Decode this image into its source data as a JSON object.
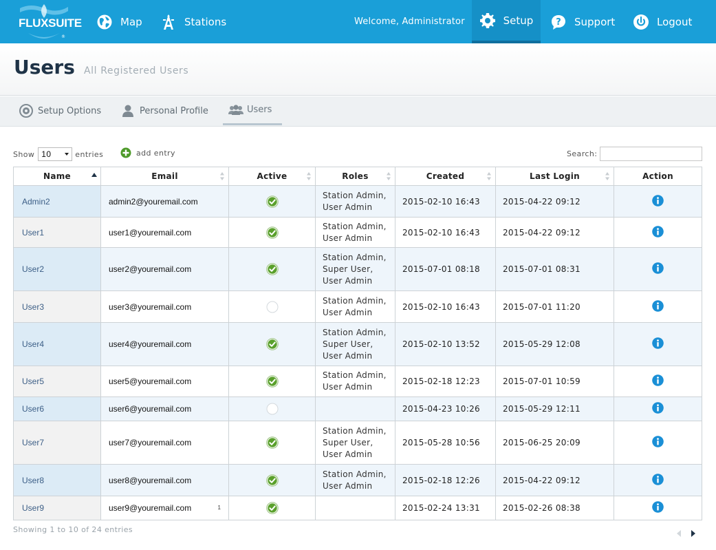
{
  "brand": {
    "logo_text": "FLUXSUITE",
    "reg_mark": "®",
    "color": "#1a9fd8"
  },
  "nav": {
    "map_label": "Map",
    "stations_label": "Stations",
    "welcome_text": "Welcome, Administrator",
    "setup_label": "Setup",
    "support_label": "Support",
    "logout_label": "Logout"
  },
  "page": {
    "title": "Users",
    "subtitle": "All Registered Users"
  },
  "subtabs": [
    {
      "label": "Setup Options",
      "icon": "gear-icon"
    },
    {
      "label": "Personal Profile",
      "icon": "person-icon"
    },
    {
      "label": "Users",
      "icon": "users-icon",
      "active": true
    }
  ],
  "controls": {
    "show_label": "Show",
    "page_length": "10",
    "entries_label": "entries",
    "add_entry_label": "add entry",
    "search_label": "Search:",
    "search_value": ""
  },
  "table": {
    "columns": [
      "Name",
      "Email",
      "Active",
      "Roles",
      "Created",
      "Last Login",
      "Action"
    ],
    "sorted_column": "Name",
    "sort_direction": "ascending",
    "rows": [
      {
        "name": "Admin2",
        "email": "admin2@youremail.com",
        "active": true,
        "roles": [
          "Station Admin,",
          "User Admin"
        ],
        "created": "2015-02-10 16:43",
        "last_login": "2015-04-22 09:12"
      },
      {
        "name": "User1",
        "email": "user1@youremail.com",
        "active": true,
        "roles": [
          "Station Admin,",
          "User Admin"
        ],
        "created": "2015-02-10 16:43",
        "last_login": "2015-04-22 09:12"
      },
      {
        "name": "User2",
        "email": "user2@youremail.com",
        "active": true,
        "roles": [
          "Station Admin,",
          "Super User,",
          "User Admin"
        ],
        "created": "2015-07-01 08:18",
        "last_login": "2015-07-01 08:31"
      },
      {
        "name": "User3",
        "email": "user3@youremail.com",
        "active": false,
        "roles": [
          "Station Admin,",
          "User Admin"
        ],
        "created": "2015-02-10 16:43",
        "last_login": "2015-07-01 11:20"
      },
      {
        "name": "User4",
        "email": "user4@youremail.com",
        "active": true,
        "roles": [
          "Station Admin,",
          "Super User,",
          "User Admin"
        ],
        "created": "2015-02-10 13:52",
        "last_login": "2015-05-29 12:08"
      },
      {
        "name": "User5",
        "email": "user5@youremail.com",
        "active": true,
        "roles": [
          "Station Admin,",
          "User Admin"
        ],
        "created": "2015-02-18 12:23",
        "last_login": "2015-07-01 10:59"
      },
      {
        "name": "User6",
        "email": "user6@youremail.com",
        "active": false,
        "roles": [],
        "created": "2015-04-23 10:26",
        "last_login": "2015-05-29 12:11"
      },
      {
        "name": "User7",
        "email": "user7@youremail.com",
        "active": true,
        "roles": [
          "Station Admin,",
          "Super User,",
          "User Admin"
        ],
        "created": "2015-05-28 10:56",
        "last_login": "2015-06-25 20:09"
      },
      {
        "name": "User8",
        "email": "user8@youremail.com",
        "active": true,
        "roles": [
          "Station Admin,",
          "User Admin"
        ],
        "created": "2015-02-18 12:26",
        "last_login": "2015-04-22 09:12"
      },
      {
        "name": "User9",
        "email": "user9@youremail.com",
        "email_mark": "1",
        "active": true,
        "roles": [],
        "created": "2015-02-24 13:31",
        "last_login": "2015-02-26 08:38"
      }
    ]
  },
  "footer": {
    "info_text": "Showing 1 to 10 of 24 entries"
  },
  "icons": {
    "active": "check-circle-icon",
    "inactive": "empty-circle-icon",
    "action": "info-icon"
  },
  "colors": {
    "accent": "#1a9fd8",
    "check_green": "#5aa02c",
    "info_blue": "#1a8fd6",
    "name_link": "#3c5e86"
  }
}
